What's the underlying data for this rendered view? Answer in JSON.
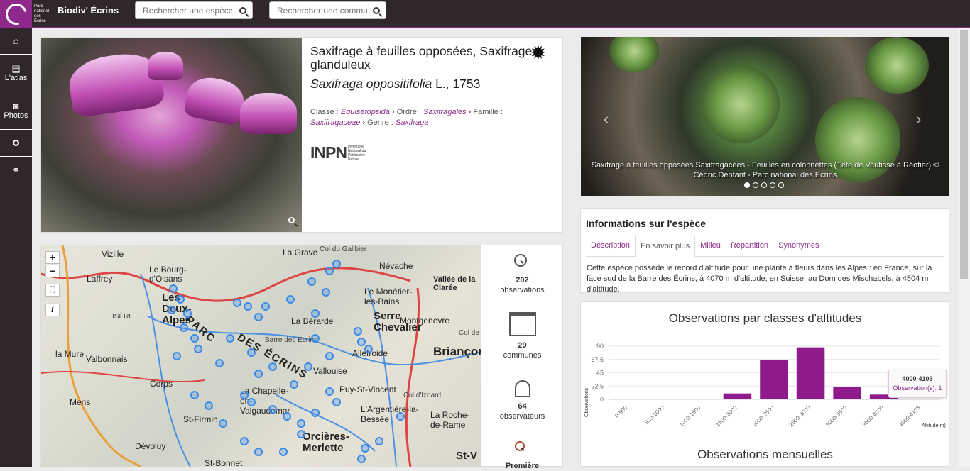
{
  "header": {
    "logo_text": "Parc national des Écrins",
    "brand": "Biodiv' Écrins",
    "search_species_placeholder": "Rechercher une espèce",
    "search_commune_placeholder": "Rechercher une commune"
  },
  "sidebar": {
    "items": [
      {
        "icon": "home-icon",
        "label": ""
      },
      {
        "icon": "book-icon",
        "label": "L'atlas"
      },
      {
        "icon": "camera-icon",
        "label": "Photos"
      },
      {
        "icon": "search-icon",
        "label": ""
      },
      {
        "icon": "link-icon",
        "label": ""
      }
    ]
  },
  "species": {
    "common_name": "Saxifrage à feuilles opposées, Saxifrage glanduleux",
    "scientific_name": "Saxifraga oppositifolia",
    "author": " L., 1753",
    "taxonomy": {
      "classe_label": "Classe :",
      "classe": "Equisetopsida",
      "ordre_label": "Ordre :",
      "ordre": "Saxifragales",
      "famille_label": "Famille :",
      "famille": "Saxifragaceae",
      "genre_label": "Genre :",
      "genre": "Saxifraga"
    },
    "inpn_logo": "INPN",
    "inpn_sub": "Inventaire National du Patrimoine Naturel"
  },
  "carousel": {
    "caption": "Saxifrage à feuilles opposées Saxifragacées - Feuilles en colonnettes (Tête de Vautisse à Réotier) © Cédric Dentant - Parc national des Ecrins",
    "slides": 5,
    "active_slide": 1
  },
  "info": {
    "title": "Informations sur l'espèce",
    "tabs": [
      "Description",
      "En savoir plus",
      "Milieu",
      "Répartition",
      "Synonymes"
    ],
    "active_tab": "En savoir plus",
    "text": "Cette espèce possède le record d'altitude pour une plante à fleurs dans les Alpes : en France, sur la face sud de la Barre des Écrins, à 4070 m d'altitude; en Suisse, au Dom des Mischabels, à 4504 m d'altitude."
  },
  "stats": {
    "observations_count": "202",
    "observations_label": "observations",
    "communes_count": "29",
    "communes_label": "communes",
    "observateurs_count": "64",
    "observateurs_label": "observateurs",
    "premiere_label": "Première"
  },
  "map": {
    "labels": [
      "Vizille",
      "La Grave",
      "Col du Galibier",
      "Névache",
      "Vallée de la Clarée",
      "Le Bourg-d'Oisans",
      "Laffrey",
      "Les Deux-Alpes",
      "La Bérarde",
      "Le Monêtier-les-Bains",
      "Serre Chevalier",
      "Montgenèvre",
      "Briançon",
      "la Mure",
      "Valbonnais",
      "Ailefroide",
      "Vallouise",
      "Corps",
      "Mens",
      "Puy-St-Vincent",
      "L'Argentière-la-Bessée",
      "La Roche-de-Rame",
      "St-Firmin",
      "Orcières-Merlette",
      "Dévoluy",
      "St-Bonnet",
      "Barre des Écrins",
      "La Chapelle-en-Valgaudemar",
      "Col d'Izoard",
      "DES ÉCRINS",
      "PARC",
      "ISÈRE",
      "St-V",
      "Col de"
    ],
    "controls": [
      "+",
      "−"
    ]
  },
  "chart_data": {
    "type": "bar",
    "title": "Observations par classes d'altitudes",
    "xlabel": "Altitude(m)",
    "ylabel": "Observations",
    "categories": [
      "0-500",
      "500-1000",
      "1000-1500",
      "1500-2000",
      "2000-2500",
      "2500-3000",
      "3000-3500",
      "3500-4000",
      "4000-4103"
    ],
    "values": [
      0,
      0,
      0,
      10,
      66,
      88,
      21,
      8,
      1
    ],
    "yticks": [
      "0",
      "22.5",
      "45",
      "67.5",
      "90"
    ],
    "ylim": [
      0,
      90
    ],
    "color": "#8e1a8c",
    "tooltip_title": "4000-4103",
    "tooltip_value": "Observation(s): 1"
  },
  "chart2_title": "Observations mensuelles"
}
